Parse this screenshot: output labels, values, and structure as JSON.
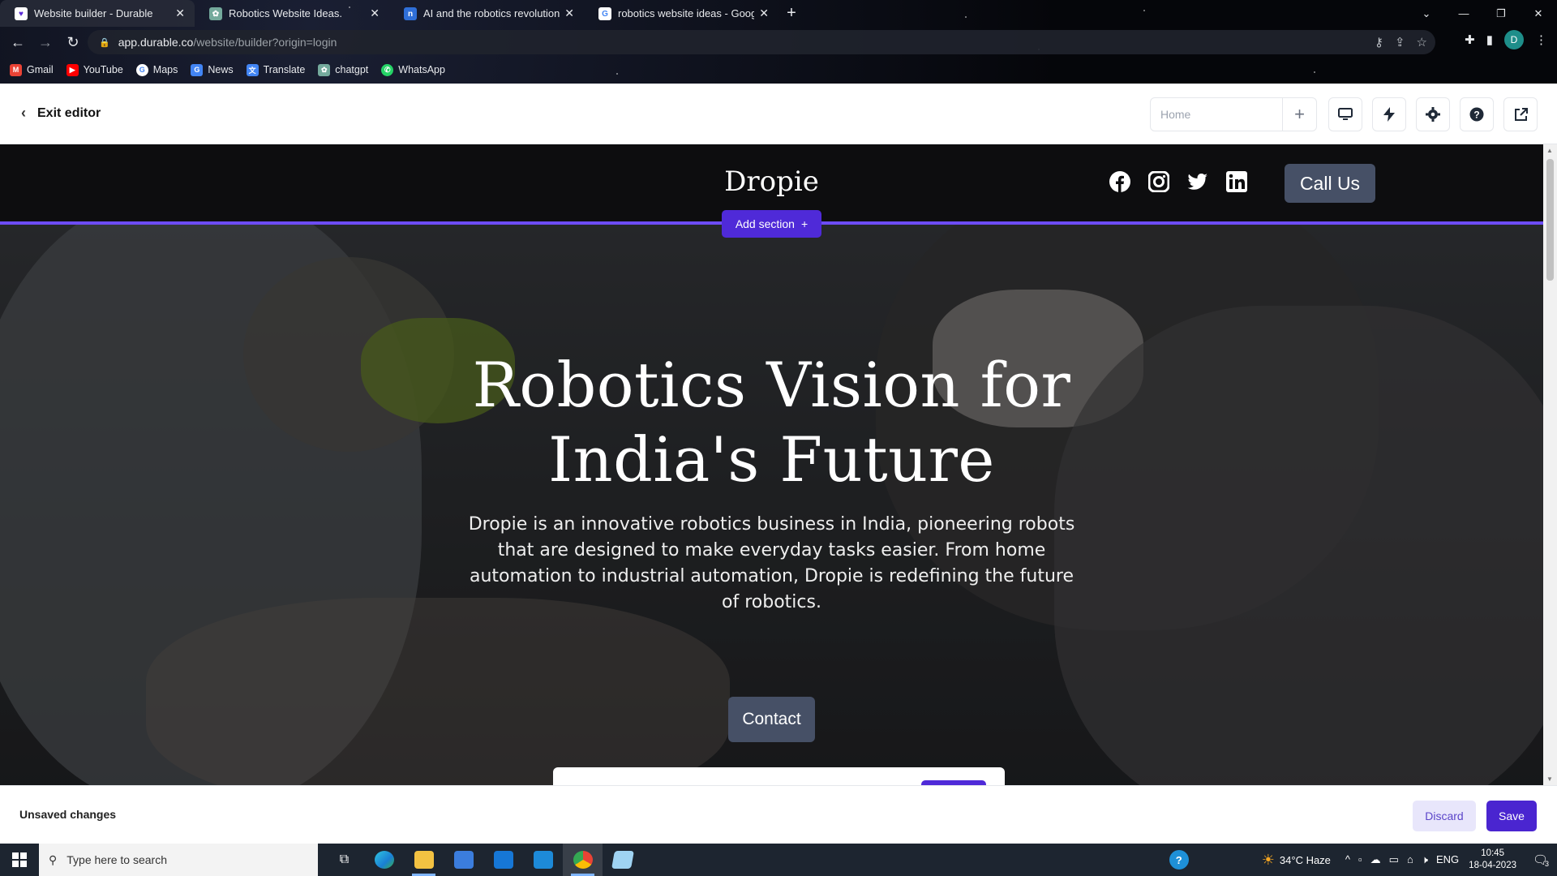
{
  "browser": {
    "tabs": [
      {
        "label": "Website builder - Durable",
        "favicon": "durable-icon",
        "color": "#ffffff",
        "active": true
      },
      {
        "label": "Robotics Website Ideas.",
        "favicon": "chatgpt-icon",
        "color": "#74aa9c",
        "active": false
      },
      {
        "label": "AI and the robotics revolution W",
        "favicon": "notion-n-icon",
        "color": "#2f6fd8",
        "active": false
      },
      {
        "label": "robotics website ideas - Google",
        "favicon": "google-icon",
        "color": "#ffffff",
        "active": false
      }
    ],
    "url_host": "app.durable.co",
    "url_path": "/website/builder?origin=login",
    "profile_initial": "D",
    "bookmarks": [
      {
        "label": "Gmail",
        "icon": "gmail-icon",
        "color": "#ea4335"
      },
      {
        "label": "YouTube",
        "icon": "youtube-icon",
        "color": "#ff0000"
      },
      {
        "label": "Maps",
        "icon": "google-icon",
        "color": "#4285f4"
      },
      {
        "label": "News",
        "icon": "news-icon",
        "color": "#4285f4"
      },
      {
        "label": "Translate",
        "icon": "translate-icon",
        "color": "#4285f4"
      },
      {
        "label": "chatgpt",
        "icon": "chatgpt-icon",
        "color": "#74aa9c"
      },
      {
        "label": "WhatsApp",
        "icon": "whatsapp-icon",
        "color": "#25d366"
      }
    ]
  },
  "editor": {
    "exit_label": "Exit editor",
    "page_placeholder": "Home",
    "unsaved_label": "Unsaved changes",
    "discard_label": "Discard",
    "save_label": "Save",
    "add_section_label": "Add section"
  },
  "site": {
    "brand": "Dropie",
    "call_us_label": "Call Us",
    "hero_title_line1": "Robotics Vision for",
    "hero_title_line2": "India's Future",
    "hero_subtitle": "Dropie is an innovative robotics business in India, pioneering robots that are designed to make everyday tasks easier. From home automation to industrial automation, Dropie is redefining the future of robotics.",
    "contact_label": "Contact"
  },
  "taskbar": {
    "search_placeholder": "Type here to search",
    "weather": "34°C  Haze",
    "language": "ENG",
    "time": "10:45",
    "date": "18-04-2023",
    "notification_count": "3"
  },
  "colors": {
    "accent": "#4f2ad8",
    "button_slate": "#465066"
  }
}
